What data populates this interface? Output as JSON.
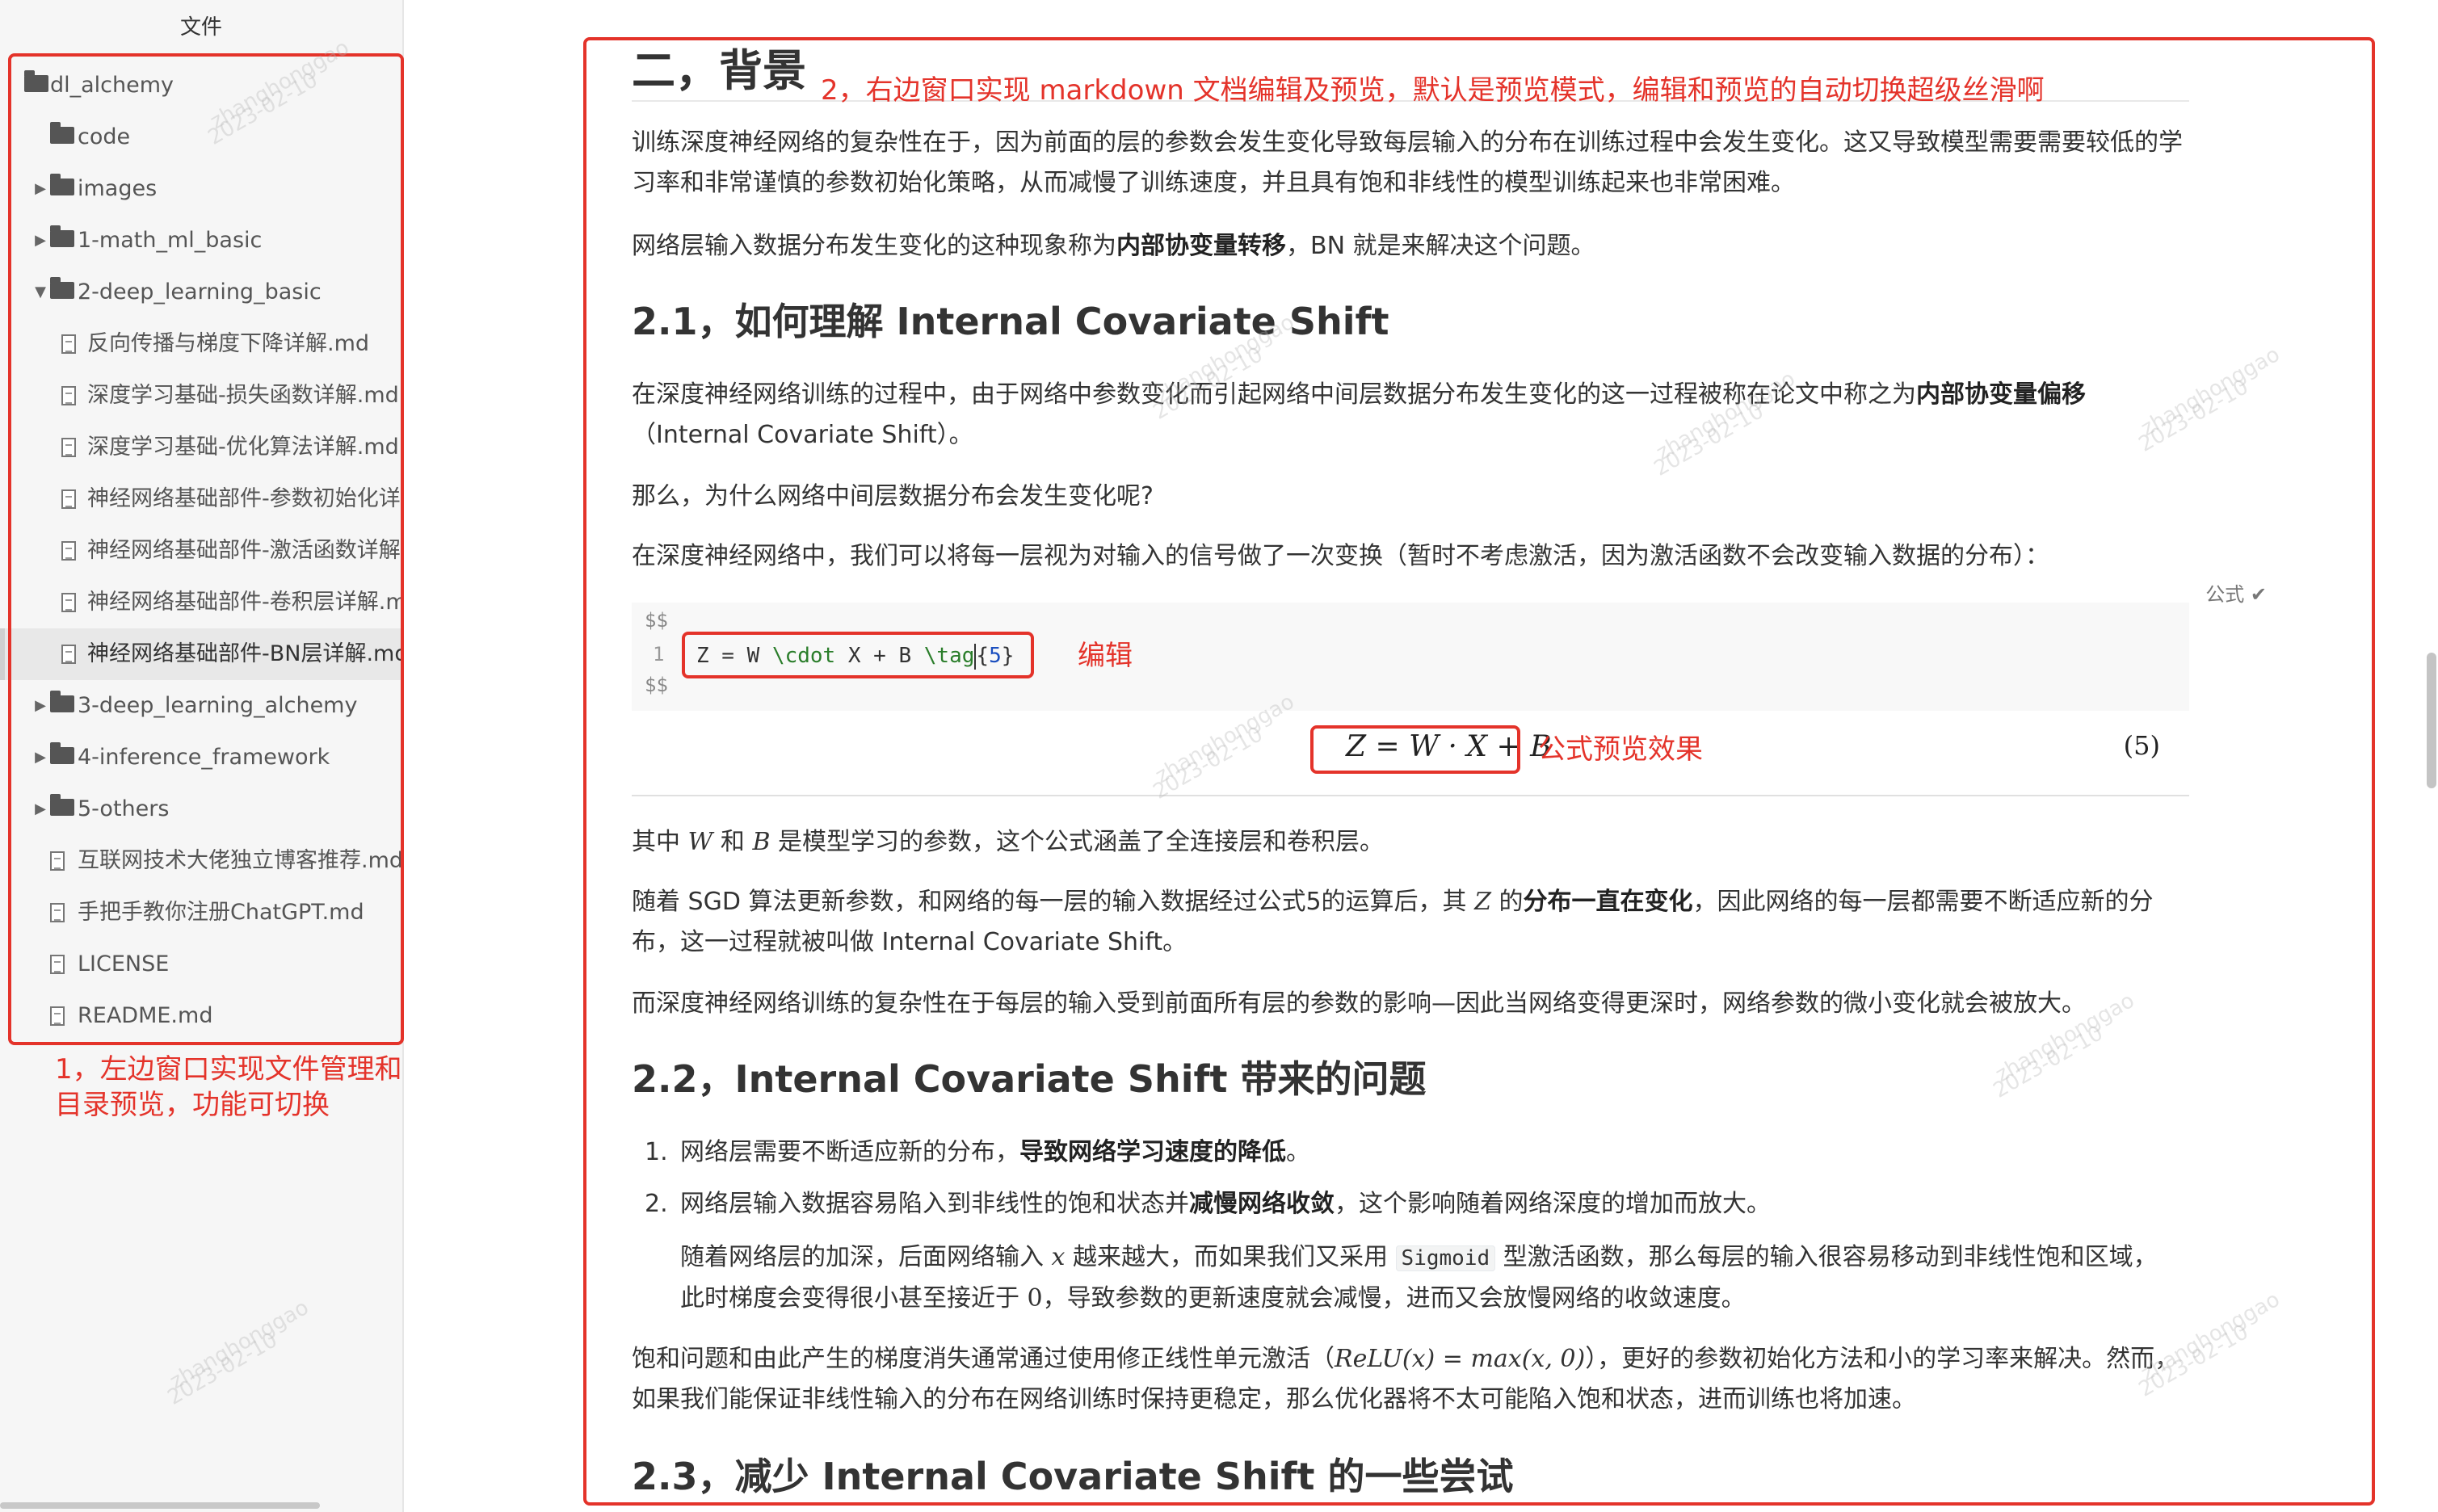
{
  "sidebar": {
    "title": "文件",
    "items": [
      {
        "label": "dl_alchemy",
        "type": "folder",
        "depth": 0,
        "caret": ""
      },
      {
        "label": "code",
        "type": "folder",
        "depth": 1,
        "caret": ""
      },
      {
        "label": "images",
        "type": "folder",
        "depth": 1,
        "caret": "▶"
      },
      {
        "label": "1-math_ml_basic",
        "type": "folder",
        "depth": 1,
        "caret": "▶"
      },
      {
        "label": "2-deep_learning_basic",
        "type": "folder",
        "depth": 1,
        "caret": "▼"
      },
      {
        "label": "反向传播与梯度下降详解.md",
        "type": "file",
        "depth": 2,
        "caret": ""
      },
      {
        "label": "深度学习基础-损失函数详解.md",
        "type": "file",
        "depth": 2,
        "caret": ""
      },
      {
        "label": "深度学习基础-优化算法详解.md",
        "type": "file",
        "depth": 2,
        "caret": ""
      },
      {
        "label": "神经网络基础部件-参数初始化详解.md",
        "type": "file",
        "depth": 2,
        "caret": ""
      },
      {
        "label": "神经网络基础部件-激活函数详解.md",
        "type": "file",
        "depth": 2,
        "caret": ""
      },
      {
        "label": "神经网络基础部件-卷积层详解.md",
        "type": "file",
        "depth": 2,
        "caret": ""
      },
      {
        "label": "神经网络基础部件-BN层详解.md",
        "type": "file",
        "depth": 2,
        "caret": "",
        "active": true
      },
      {
        "label": "3-deep_learning_alchemy",
        "type": "folder",
        "depth": 1,
        "caret": "▶"
      },
      {
        "label": "4-inference_framework",
        "type": "folder",
        "depth": 1,
        "caret": "▶"
      },
      {
        "label": "5-others",
        "type": "folder",
        "depth": 1,
        "caret": "▶"
      },
      {
        "label": "互联网技术大佬独立博客推荐.md",
        "type": "file",
        "depth": 1,
        "caret": ""
      },
      {
        "label": "手把手教你注册ChatGPT.md",
        "type": "file",
        "depth": 1,
        "caret": ""
      },
      {
        "label": "LICENSE",
        "type": "file",
        "depth": 1,
        "caret": ""
      },
      {
        "label": "README.md",
        "type": "file",
        "depth": 1,
        "caret": ""
      }
    ],
    "annotation": "1，左边窗口实现文件管理和\n目录预览，功能可切换"
  },
  "annotations": {
    "main": "2，右边窗口实现 markdown 文档编辑及预览，默认是预览模式，编辑和预览的自动切换超级丝滑啊",
    "edit": "编辑",
    "preview": "公式预览效果"
  },
  "doc": {
    "h_bg": "二，背景",
    "p1": "训练深度神经网络的复杂性在于，因为前面的层的参数会发生变化导致每层输入的分布在训练过程中会发生变化。这又导致模型需要需要较低的学习率和非常谨慎的参数初始化策略，从而减慢了训练速度，并且具有饱和非线性的模型训练起来也非常困难。",
    "p2_a": "网络层输入数据分布发生变化的这种现象称为",
    "p2_b": "内部协变量转移",
    "p2_c": "，BN 就是来解决这个问题。",
    "h21": "2.1，如何理解 Internal Covariate Shift",
    "p3_a": "在深度神经网络训练的过程中，由于网络中参数变化而引起网络中间层数据分布发生变化的这一过程被称在论文中称之为",
    "p3_b": "内部协变量偏移",
    "p3_c": "（Internal Covariate Shift）。",
    "p4": "那么，为什么网络中间层数据分布会发生变化呢?",
    "p5": "在深度神经网络中，我们可以将每一层视为对输入的信号做了一次变换（暂时不考虑激活，因为激活函数不会改变输入数据的分布）：",
    "formula_tag": "公式 ✔",
    "dollar_open": "$$",
    "dollar_close": "$$",
    "line_no": "1",
    "code_a": "Z = W ",
    "code_cdot": "\\cdot",
    "code_b": " X + B ",
    "code_tag": "\\tag",
    "code_brace_open": "{",
    "code_num": "5",
    "code_brace_close": "}",
    "formula": "Z = W · X + B",
    "eq_number": "(5)",
    "p6_a": "其中 ",
    "p6_w": "W",
    "p6_and": " 和 ",
    "p6_b": "B",
    "p6_c": " 是模型学习的参数，这个公式涵盖了全连接层和卷积层。",
    "p7_a": "随着 SGD 算法更新参数，和网络的每一层的输入数据经过公式5的运算后，其 ",
    "p7_z": "Z",
    "p7_b": " 的",
    "p7_bold": "分布一直在变化",
    "p7_c": "，因此网络的每一层都需要不断适应新的分布，这一过程就被叫做 Internal Covariate Shift。",
    "p8": "而深度神经网络训练的复杂性在于每层的输入受到前面所有层的参数的影响—因此当网络变得更深时，网络参数的微小变化就会被放大。",
    "h22": "2.2，Internal Covariate Shift 带来的问题",
    "li1_num": "1.",
    "li1_a": "网络层需要不断适应新的分布，",
    "li1_bold": "导致网络学习速度的降低",
    "li1_c": "。",
    "li2_num": "2.",
    "li2_a": "网络层输入数据容易陷入到非线性的饱和状态并",
    "li2_bold": "减慢网络收敛",
    "li2_c": "，这个影响随着网络深度的增加而放大。",
    "li2_sub_a": "随着网络层的加深，后面网络输入 ",
    "li2_sub_x": "x",
    "li2_sub_b": " 越来越大，而如果我们又采用 ",
    "li2_sub_code": "Sigmoid",
    "li2_sub_c": " 型激活函数，那么每层的输入很容易移动到非线性饱和区域，此时梯度会变得很小甚至接近于 ",
    "li2_sub_zero": "0",
    "li2_sub_d": "，导致参数的更新速度就会减慢，进而又会放慢网络的收敛速度。",
    "p9_a": "饱和问题和由此产生的梯度消失通常通过使用修正线性单元激活（",
    "p9_math": "ReLU(x) = max(x, 0)",
    "p9_b": "），更好的参数初始化方法和小的学习率来解决。然而，如果我们能保证非线性输入的分布在网络训练时保持更稳定，那么优化器将不太可能陷入饱和状态，进而训练也将加速。",
    "h23": "2.3，减少 Internal Covariate Shift 的一些尝试"
  },
  "watermark": {
    "name": "zhanghonggao",
    "date": "2023-02-10"
  },
  "colors": {
    "annotation": "#e4332a",
    "sidebar_bg": "#f6f6f6"
  }
}
